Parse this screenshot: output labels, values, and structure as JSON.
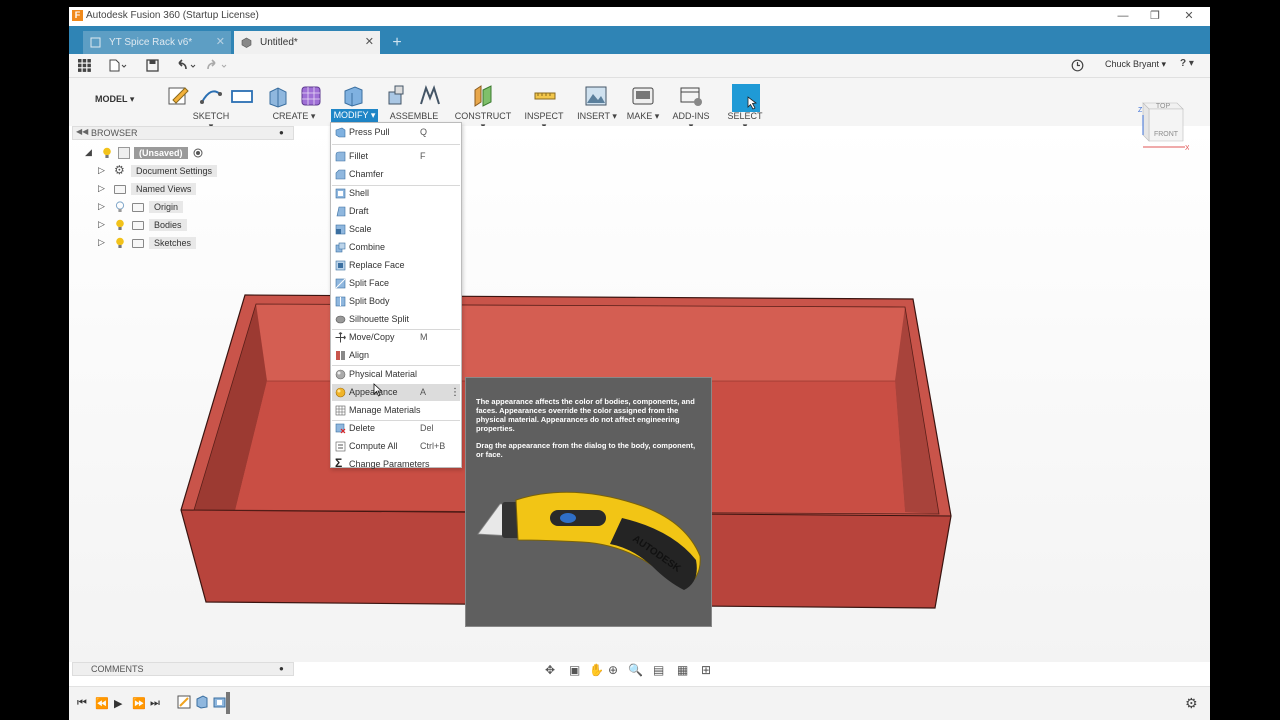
{
  "window": {
    "title": "Autodesk Fusion 360 (Startup License)",
    "app_icon_letter": "F",
    "controls": [
      "—",
      "❐",
      "✕"
    ]
  },
  "tabs": [
    {
      "label": "YT Spice Rack v6*",
      "active": false
    },
    {
      "label": "Untitled*",
      "active": true
    }
  ],
  "new_tab_label": "+",
  "user": {
    "name": "Chuck Bryant ▾",
    "help": "? ▾"
  },
  "toolbar": {
    "workspace": "MODEL ▾",
    "groups": [
      {
        "label": "SKETCH ▾"
      },
      {
        "label": "CREATE ▾"
      },
      {
        "label": "MODIFY ▾",
        "active": true
      },
      {
        "label": "ASSEMBLE ▾"
      },
      {
        "label": "CONSTRUCT ▾"
      },
      {
        "label": "INSPECT ▾"
      },
      {
        "label": "INSERT ▾"
      },
      {
        "label": "MAKE ▾"
      },
      {
        "label": "ADD-INS ▾"
      },
      {
        "label": "SELECT ▾"
      }
    ]
  },
  "browser": {
    "title": "BROWSER",
    "root": "(Unsaved)",
    "items": [
      {
        "label": "Document Settings",
        "icon": "gear-icon"
      },
      {
        "label": "Named Views",
        "icon": "folder-icon"
      },
      {
        "label": "Origin",
        "icon": "folder-icon"
      },
      {
        "label": "Bodies",
        "icon": "folder-icon"
      },
      {
        "label": "Sketches",
        "icon": "folder-icon"
      }
    ]
  },
  "modify_menu": {
    "items": [
      {
        "label": "Press Pull",
        "key": "Q",
        "icon": "press-pull-icon"
      },
      {
        "label": "Fillet",
        "key": "F",
        "icon": "fillet-icon"
      },
      {
        "label": "Chamfer",
        "key": "",
        "icon": "chamfer-icon"
      },
      {
        "label": "Shell",
        "key": "",
        "icon": "shell-icon"
      },
      {
        "label": "Draft",
        "key": "",
        "icon": "draft-icon"
      },
      {
        "label": "Scale",
        "key": "",
        "icon": "scale-icon"
      },
      {
        "label": "Combine",
        "key": "",
        "icon": "combine-icon"
      },
      {
        "label": "Replace Face",
        "key": "",
        "icon": "replace-face-icon"
      },
      {
        "label": "Split Face",
        "key": "",
        "icon": "split-face-icon"
      },
      {
        "label": "Split Body",
        "key": "",
        "icon": "split-body-icon"
      },
      {
        "label": "Silhouette Split",
        "key": "",
        "icon": "silhouette-split-icon"
      },
      {
        "label": "Move/Copy",
        "key": "M",
        "icon": "move-icon"
      },
      {
        "label": "Align",
        "key": "",
        "icon": "align-icon"
      },
      {
        "label": "Physical Material",
        "key": "",
        "icon": "physical-material-icon"
      },
      {
        "label": "Appearance",
        "key": "A",
        "icon": "appearance-icon",
        "highlighted": true
      },
      {
        "label": "Manage Materials",
        "key": "",
        "icon": "manage-materials-icon"
      },
      {
        "label": "Delete",
        "key": "Del",
        "icon": "delete-icon"
      },
      {
        "label": "Compute All",
        "key": "Ctrl+B",
        "icon": "compute-icon"
      },
      {
        "label": "Change Parameters",
        "key": "",
        "icon": "sigma-icon"
      }
    ]
  },
  "tooltip": {
    "p1": "The appearance affects the color of bodies, components, and faces. Appearances override the color assigned from the physical material. Appearances do not affect engineering properties.",
    "p2": "Drag the appearance from the dialog to the body, component, or face.",
    "brand": "AUTODESK"
  },
  "viewcube": {
    "top": "TOP",
    "front": "FRONT",
    "z": "Z",
    "x": "X"
  },
  "comments": {
    "title": "COMMENTS"
  },
  "colors": {
    "accent": "#1f86c7",
    "tab_bar": "#2f84b5",
    "box_red": "#b8443c"
  }
}
